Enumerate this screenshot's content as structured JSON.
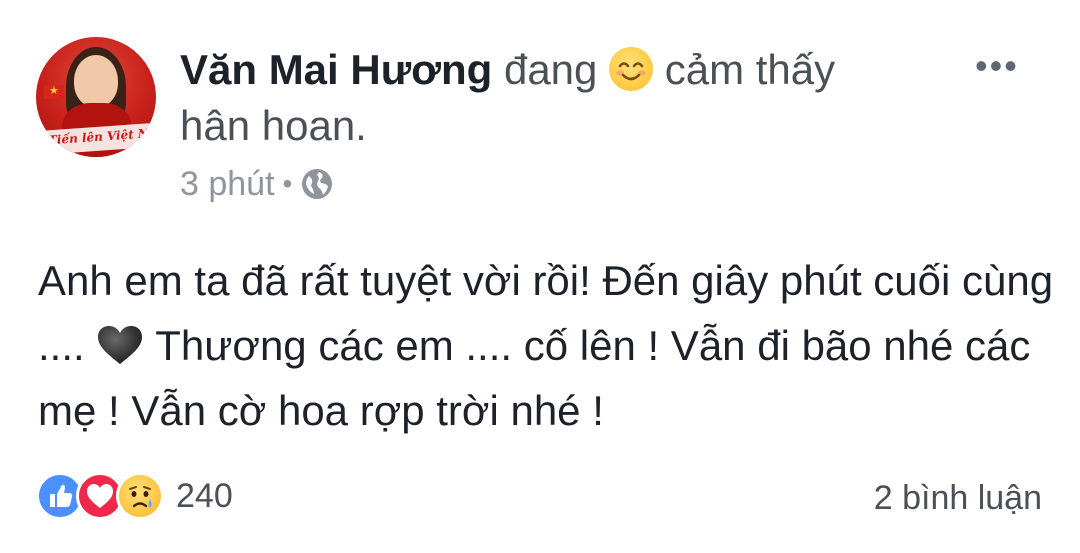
{
  "post": {
    "author": "Văn Mai Hương",
    "status_prefix": "đang",
    "feeling_emoji": "smiling-face-icon",
    "status_suffix": "cảm thấy",
    "feeling": "hân hoan.",
    "time": "3 phút",
    "separator": "•",
    "privacy_icon": "globe-icon",
    "more_icon": "•••",
    "text_part1": "Anh em ta đã rất tuyệt vời rồi! Đến giây phút cuối cùng ....",
    "text_emoji": "black-heart-icon",
    "text_part2": "Thương các em .... cố lên ! Vẫn đi bão nhé các mẹ ! Vẫn cờ hoa rợp trời nhé !",
    "avatar_badge_text": "Tiến lên Việt Nam ơi!"
  },
  "reactions": {
    "icons": [
      "like-icon",
      "love-icon",
      "sad-icon"
    ],
    "count": "240",
    "comments": "2 bình luận"
  },
  "colors": {
    "like": "#4a90ff",
    "love": "#f0284a",
    "sad": "#fcc23d",
    "meta_text": "#90949c"
  }
}
